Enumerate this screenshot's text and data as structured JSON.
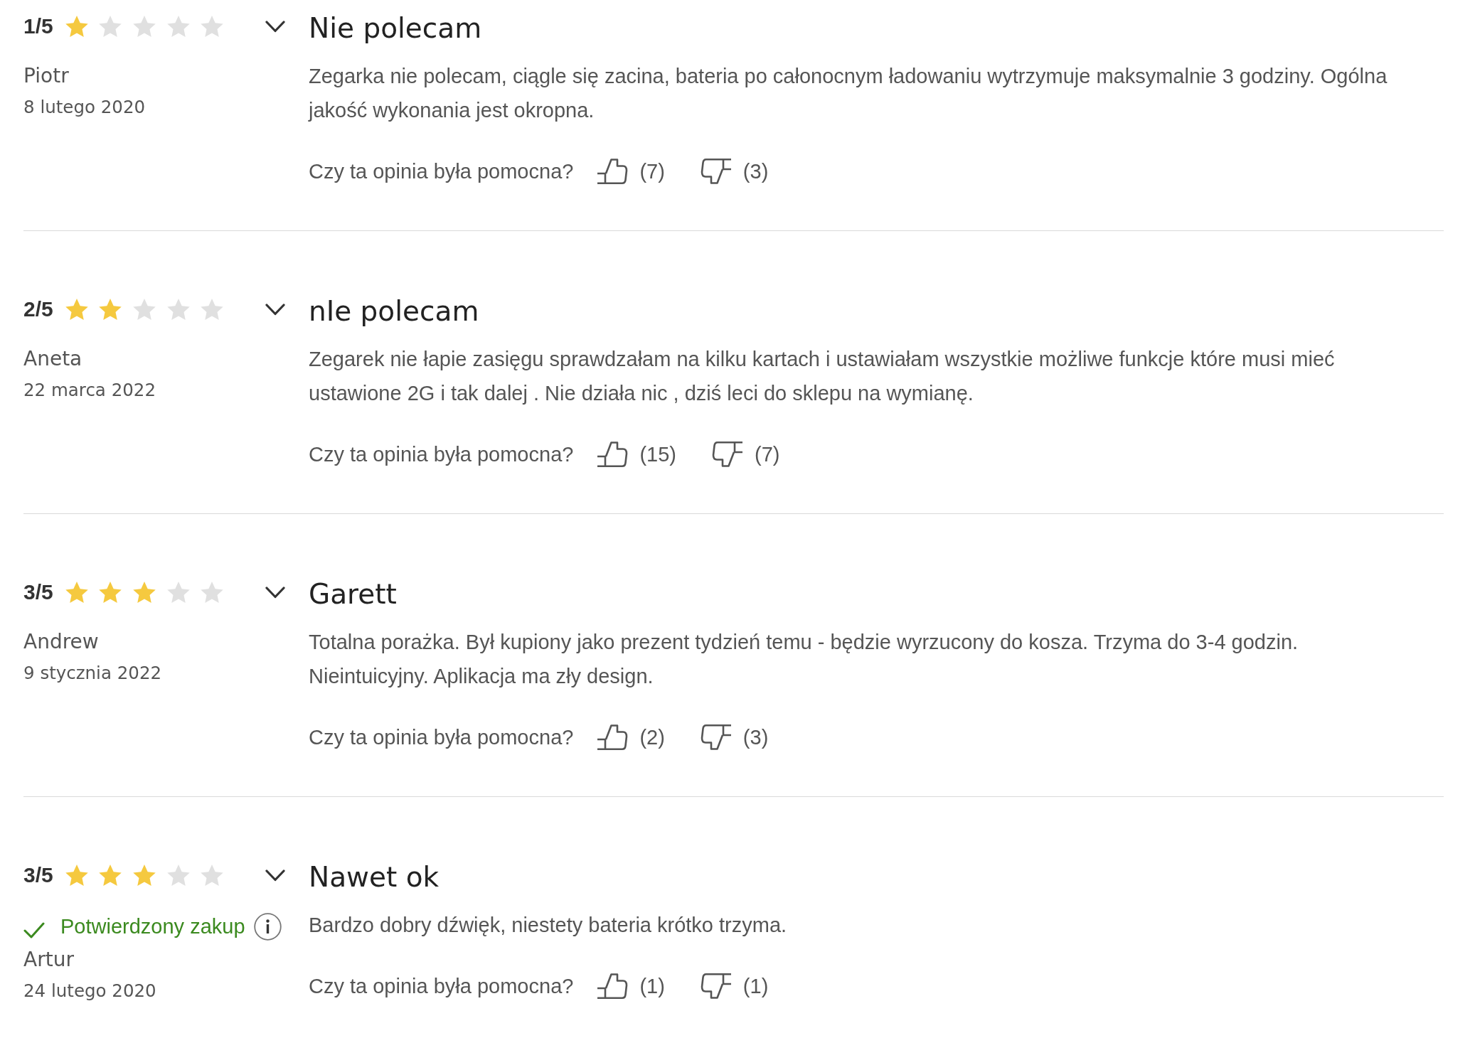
{
  "reviews": [
    {
      "rating": "1/5",
      "stars": 1,
      "title": "Nie polecam",
      "author": "Piotr",
      "date": "8 lutego 2020",
      "body": "Zegarka nie polecam, ciągle się zacina, bateria po całonocnym ładowaniu wytrzymuje maksymalnie 3 godziny. Ogólna jakość wykonania jest okropna.",
      "helpful": {
        "question": "Czy ta opinia była pomocna?",
        "upvotes": "(7)",
        "downvotes": "(3)"
      }
    },
    {
      "rating": "2/5",
      "stars": 2,
      "title": "nIe polecam",
      "author": "Aneta",
      "date": "22 marca 2022",
      "body": "Zegarek nie łapie zasięgu sprawdzałam na kilku kartach i ustawiałam wszystkie możliwe funkcje które musi mieć ustawione 2G i tak dalej . Nie działa nic , dziś leci do sklepu na wymianę.",
      "helpful": {
        "question": "Czy ta opinia była pomocna?",
        "upvotes": "(15)",
        "downvotes": "(7)"
      }
    },
    {
      "rating": "3/5",
      "stars": 3,
      "title": "Garett",
      "author": "Andrew",
      "date": "9 stycznia 2022",
      "body": "Totalna porażka. Był kupiony jako prezent tydzień temu - będzie wyrzucony do kosza. Trzyma do 3-4 godzin. Nieintuicyjny. Aplikacja ma zły design.",
      "helpful": {
        "question": "Czy ta opinia była pomocna?",
        "upvotes": "(2)",
        "downvotes": "(3)"
      }
    },
    {
      "rating": "3/5",
      "stars": 3,
      "title": "Nawet ok",
      "verified_purchase": "Potwierdzony zakup",
      "author": "Artur",
      "date": "24 lutego 2020",
      "body": "Bardzo dobry dźwięk, niestety bateria krótko trzyma.",
      "helpful": {
        "question": "Czy ta opinia była pomocna?",
        "upvotes": "(1)",
        "downvotes": "(1)"
      }
    }
  ]
}
